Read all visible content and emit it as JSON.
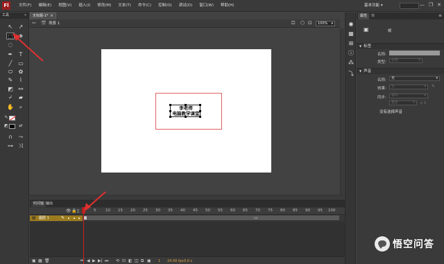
{
  "app": {
    "logo": "Fl"
  },
  "menu": [
    "文件(F)",
    "编辑(E)",
    "视图(V)",
    "插入(I)",
    "修改(M)",
    "文本(T)",
    "命令(C)",
    "控制(O)",
    "调试(D)",
    "窗口(W)",
    "帮助(H)"
  ],
  "workspace": {
    "label": "基本功能"
  },
  "window_controls": {
    "minimize": "—",
    "restore": "❐",
    "close": "✕"
  },
  "toolbox": {
    "title": "工具"
  },
  "document": {
    "tab_title": "无标题-1*",
    "tab_close": "×",
    "scene_label": "场景 1",
    "zoom": "100%"
  },
  "stage": {
    "line1": "李老师",
    "line2": "电脑教学课堂"
  },
  "timeline": {
    "tabs": [
      "时间轴",
      "输出"
    ],
    "frame_numbers": [
      "1",
      "5",
      "10",
      "15",
      "20",
      "25",
      "30",
      "35",
      "40",
      "45",
      "50",
      "55",
      "60",
      "65",
      "70",
      "75",
      "80",
      "85",
      "90",
      "95",
      "100"
    ],
    "layer_name": "图层 1",
    "footer": {
      "frame": "1",
      "fps": "24.00 fps",
      "time": "0.0 s"
    }
  },
  "properties": {
    "tabs": [
      "属性",
      "库"
    ],
    "title": "帧",
    "label_section": "标签",
    "name_label": "名称:",
    "type_label": "类型:",
    "type_value": "名称",
    "sound_section": "声音",
    "sound_name_label": "名称:",
    "sound_name_value": "无",
    "effect_label": "效果:",
    "effect_value": "无",
    "sync_label": "同步:",
    "sync_value": "事件",
    "repeat_value": "重复",
    "repeat_count": "x 1",
    "status": "没有选择声音"
  },
  "watermark": {
    "text": "悟空问答"
  },
  "colors": {
    "accent": "#9c7b1f",
    "playhead": "#d02020",
    "frame_highlight": "#e06060"
  }
}
